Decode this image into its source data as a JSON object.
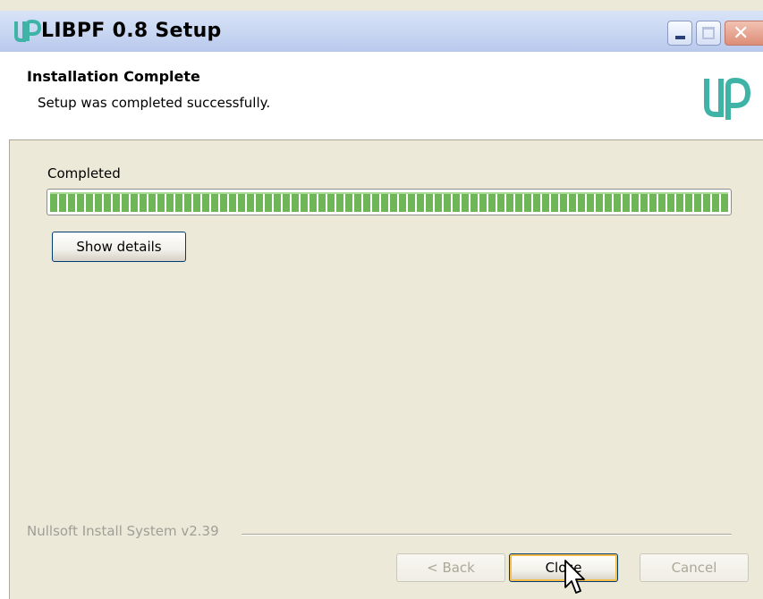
{
  "window": {
    "title": "LIBPF 0.8 Setup",
    "icon": "libpf-logo-icon",
    "controls": [
      "minimize-icon",
      "maximize-icon",
      "close-icon"
    ]
  },
  "header": {
    "title": "Installation Complete",
    "subtitle": "Setup was completed successfully.",
    "logo": "libpf-logo-icon"
  },
  "progress": {
    "label": "Completed",
    "value": 1.0,
    "color": "#6fb658"
  },
  "buttons": {
    "show_details": "Show details",
    "back": "< Back",
    "close": "Close",
    "cancel": "Cancel"
  },
  "footer": {
    "branding": "Nullsoft Install System v2.39"
  },
  "colors": {
    "accent": "#3fb3a6",
    "background": "#ece9d8",
    "focus_ring": "#f5bd4a"
  }
}
